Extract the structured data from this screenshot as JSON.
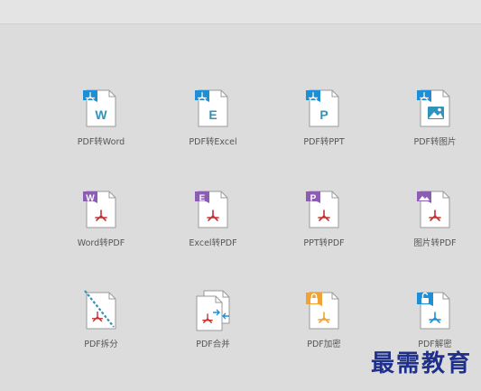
{
  "watermark": "最需教育",
  "colors": {
    "blue": "#1e8fd5",
    "purple": "#8c5eb3",
    "orange": "#f0a234",
    "teal": "#2f93bb",
    "pdf_red": "#c8302f",
    "page_border": "#9a9a9a"
  },
  "tools": [
    {
      "label": "PDF转Word",
      "badge": "W",
      "icon": "pdf-to-word-icon"
    },
    {
      "label": "PDF转Excel",
      "badge": "E",
      "icon": "pdf-to-excel-icon"
    },
    {
      "label": "PDF转PPT",
      "badge": "P",
      "icon": "pdf-to-ppt-icon"
    },
    {
      "label": "PDF转图片",
      "badge": "",
      "icon": "pdf-to-image-icon"
    },
    {
      "label": "Word转PDF",
      "badge": "W",
      "icon": "word-to-pdf-icon"
    },
    {
      "label": "Excel转PDF",
      "badge": "E",
      "icon": "excel-to-pdf-icon"
    },
    {
      "label": "PPT转PDF",
      "badge": "P",
      "icon": "ppt-to-pdf-icon"
    },
    {
      "label": "图片转PDF",
      "badge": "",
      "icon": "image-to-pdf-icon"
    },
    {
      "label": "PDF拆分",
      "badge": "",
      "icon": "pdf-split-icon"
    },
    {
      "label": "PDF合并",
      "badge": "",
      "icon": "pdf-merge-icon"
    },
    {
      "label": "PDF加密",
      "badge": "",
      "icon": "pdf-encrypt-icon"
    },
    {
      "label": "PDF解密",
      "badge": "",
      "icon": "pdf-decrypt-icon"
    }
  ]
}
